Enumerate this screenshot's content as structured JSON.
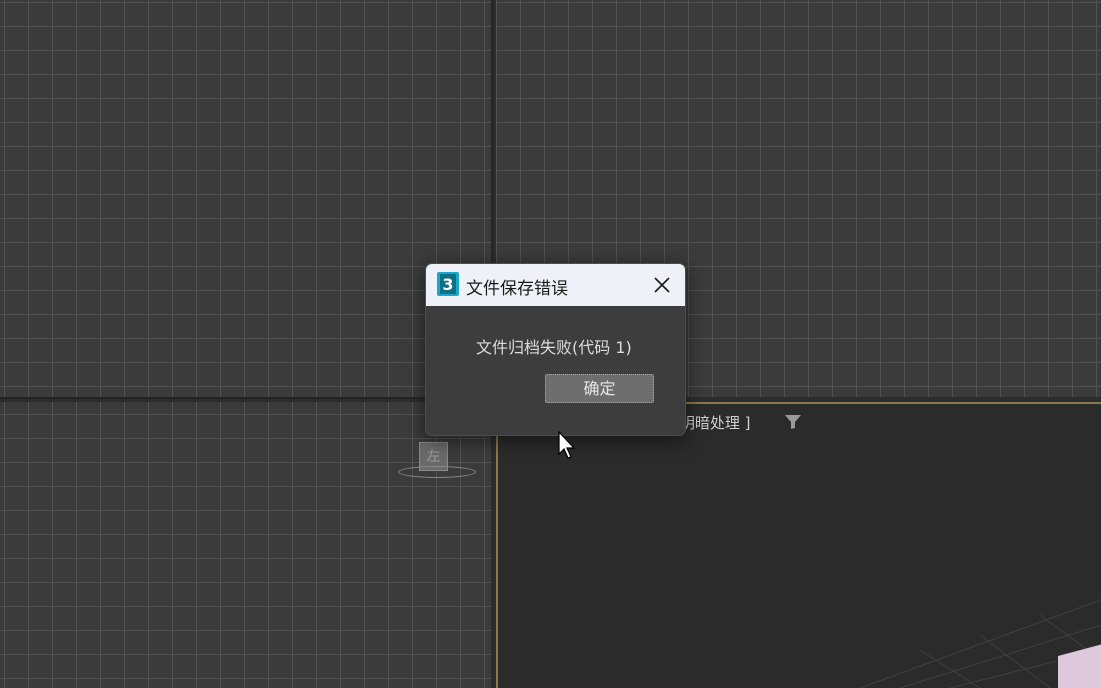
{
  "viewports": {
    "perspective_label": "[明暗处理 ]",
    "gizmo_label": "左"
  },
  "dialog": {
    "title": "文件保存错误",
    "app_icon_text": "3",
    "message": "文件归档失败(代码  1)",
    "ok_label": "确定",
    "colors": {
      "titlebar": "#eef2f8",
      "body": "#3d3d3d",
      "button": "#6e6e6e",
      "icon_accent": "#1aa7c8"
    }
  },
  "icons": {
    "close": "close-icon",
    "filter": "filter-icon",
    "app": "3dsmax-app-icon",
    "cursor": "mouse-pointer-icon"
  }
}
